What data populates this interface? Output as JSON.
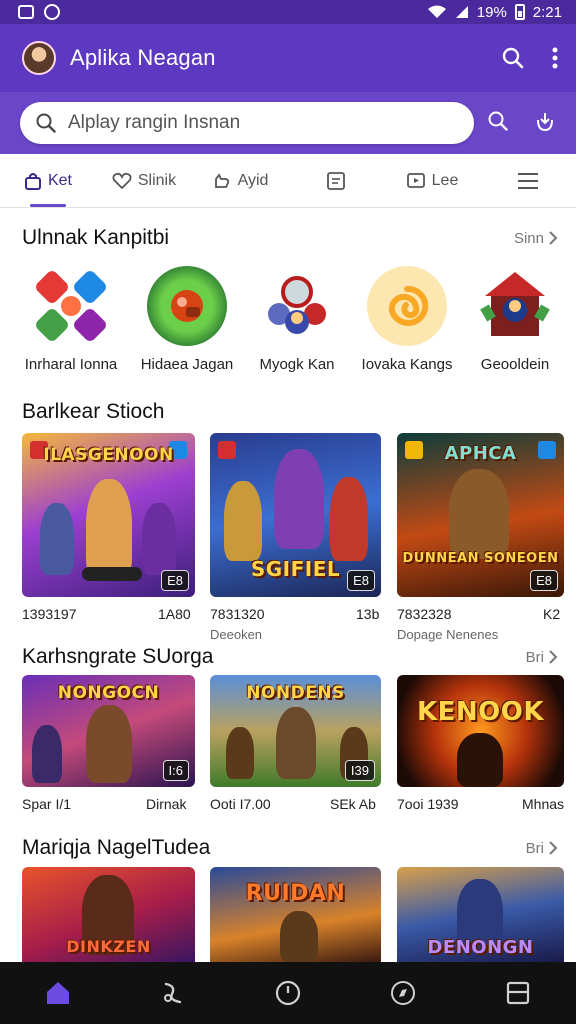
{
  "status_bar": {
    "battery": "19%",
    "time": "2:21"
  },
  "app": {
    "title": "Aplika Neagan"
  },
  "search": {
    "placeholder": "Alplay rangin Insnan"
  },
  "tabs": [
    {
      "label": "Ket",
      "icon": "bag-icon",
      "active": true
    },
    {
      "label": "Slinik",
      "icon": "heart-icon",
      "active": false
    },
    {
      "label": "Ayid",
      "icon": "hand-icon",
      "active": false
    },
    {
      "label": "",
      "icon": "document-icon",
      "active": false
    },
    {
      "label": "Lee",
      "icon": "play-icon",
      "active": false
    },
    {
      "label": "",
      "icon": "menu-icon",
      "active": false
    }
  ],
  "section1": {
    "title": "Ulnnak Kanpitbi",
    "see_all": "Sinn",
    "apps": [
      {
        "label": "Inrharal Ionna"
      },
      {
        "label": "Hidaea Jagan"
      },
      {
        "label": "Myogk Kan"
      },
      {
        "label": "Iovaka Kangs"
      },
      {
        "label": "Geooldein"
      }
    ]
  },
  "section2": {
    "title": "Barlkear Stioch",
    "cards": [
      {
        "art_title": "ILASGENOON",
        "badge": "E8",
        "name": "1393197",
        "right": "1A80",
        "sub": ""
      },
      {
        "art_title": "SGIFIEL",
        "badge": "E8",
        "name": "7831320",
        "right": "13b",
        "sub": "Deeoken"
      },
      {
        "art_title": "APHCA",
        "subtitle": "DUNNEAN SONEOEN",
        "badge": "E8",
        "name": "7832328",
        "right": "K2",
        "sub": "Dopage Nenenes"
      }
    ]
  },
  "section3": {
    "title": "Karhsngrate SUorga",
    "see_all": "Bri",
    "cards": [
      {
        "art_title": "NONGOCN",
        "badge": "I:6",
        "name": "Spar I/1",
        "right": "Dirnak"
      },
      {
        "art_title": "NONDENS",
        "badge": "I39",
        "name": "Ooti I7.00",
        "right": "SEk Ab"
      },
      {
        "art_title": "KENOOK",
        "badge": "",
        "name": "7ooi 1939",
        "right": "Mhnas"
      }
    ]
  },
  "section4": {
    "title": "Mariqja NagelTudea",
    "see_all": "Bri",
    "cards": [
      {
        "art_title": "DINKZEN"
      },
      {
        "art_title": "RUIDAN"
      },
      {
        "art_title": "DENONGN"
      }
    ]
  },
  "bottom_nav": [
    {
      "icon": "home-icon",
      "active": true
    },
    {
      "icon": "link-icon",
      "active": false
    },
    {
      "icon": "clock-icon",
      "active": false
    },
    {
      "icon": "compass-icon",
      "active": false
    },
    {
      "icon": "window-icon",
      "active": false
    }
  ],
  "colors": {
    "primary": "#5d39c2",
    "accent": "#6a46c9",
    "nav_active": "#6b4be0"
  }
}
